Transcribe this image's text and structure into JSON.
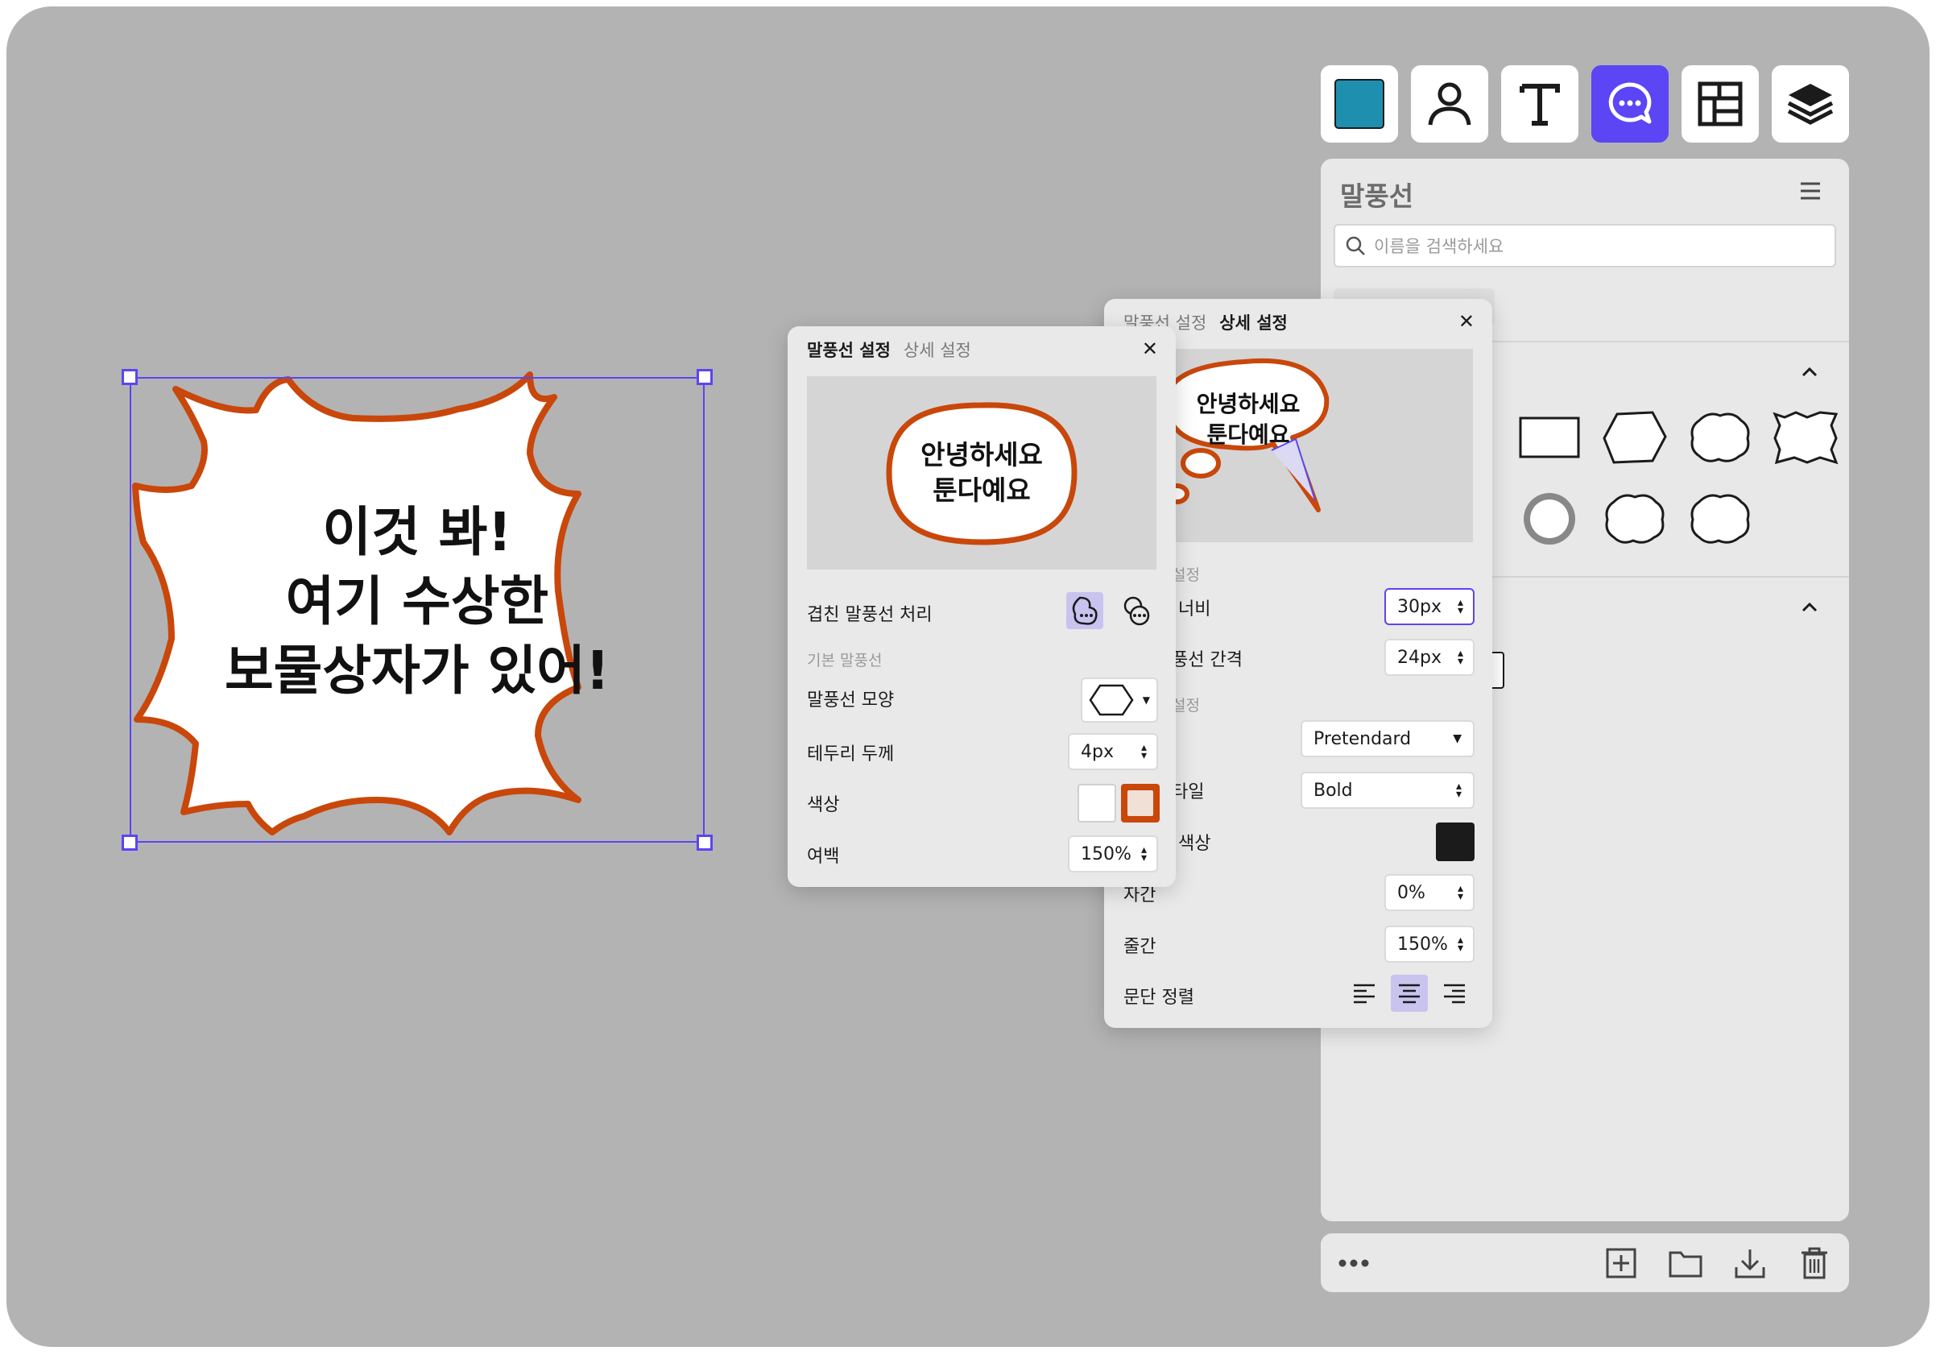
{
  "canvas": {
    "burst_text_lines": [
      "이것 봐!",
      "여기 수상한",
      "보물상자가 있어!"
    ],
    "burst_stroke_color": "#c9470a",
    "selection_color": "#5b45f4"
  },
  "toolbar": {
    "tools": [
      {
        "name": "color-tool",
        "icon": "color-swatch-icon",
        "color": "#1f8fb0"
      },
      {
        "name": "character-tool",
        "icon": "person-icon"
      },
      {
        "name": "text-tool",
        "icon": "text-T-icon"
      },
      {
        "name": "speech-bubble-tool",
        "icon": "chat-bubble-icon",
        "active": true
      },
      {
        "name": "layout-tool",
        "icon": "panel-layout-icon"
      },
      {
        "name": "layers-tool",
        "icon": "layers-icon"
      }
    ],
    "accent": "#5b45f4"
  },
  "library": {
    "title": "말풍선",
    "search_placeholder": "이름을 검색하세요",
    "partial_label": "l"
  },
  "panel_left": {
    "tab_settings": "말풍선 설정",
    "tab_detail": "상세 설정",
    "preview_text": [
      "안녕하세요",
      "툰다예요"
    ],
    "overlap_label": "겹친 말풍선 처리",
    "section_basic": "기본 말풍선",
    "shape_label": "말풍선 모양",
    "border_label": "테두리 두께",
    "border_value": "4px",
    "color_label": "색상",
    "padding_label": "여백",
    "padding_value": "150%",
    "fill_color": "#ffffff",
    "stroke_color": "#c9470a"
  },
  "panel_right": {
    "tab_settings": "말풍선 설정",
    "tab_detail": "상세 설정",
    "preview_text": [
      "안녕하세요",
      "툰다예요"
    ],
    "section_tail": "설정",
    "width_label": "너비",
    "width_value": "30px",
    "gap_label": "풍선 간격",
    "gap_value": "24px",
    "section_font": "설정",
    "font_value": "Pretendard",
    "style_label": "타일",
    "style_value": "Bold",
    "text_color_label": "색상",
    "text_color": "#1b1b1b",
    "spacing_label": "자간",
    "spacing_value": "0%",
    "line_label": "줄간",
    "line_value": "150%",
    "align_label": "문단 정렬"
  }
}
